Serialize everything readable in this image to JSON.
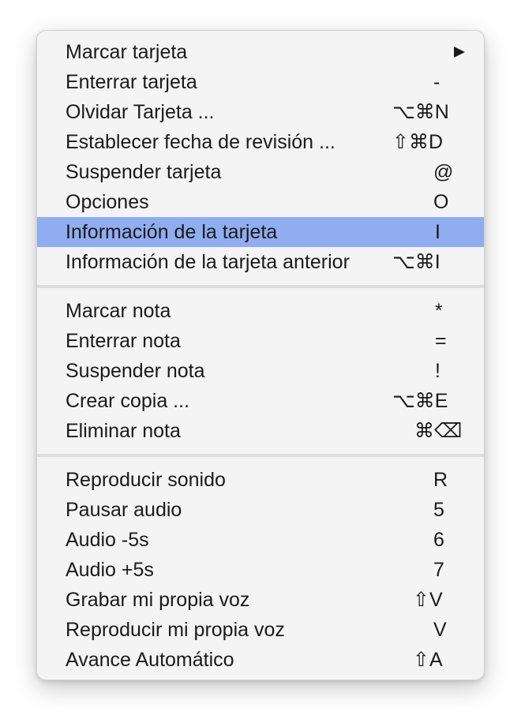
{
  "menu": {
    "items": [
      {
        "label": "Marcar tarjeta",
        "shortcut": "",
        "submenu": true
      },
      {
        "label": "Enterrar tarjeta",
        "shortcut": "-"
      },
      {
        "label": "Olvidar Tarjeta ...",
        "shortcut": "⌥⌘N"
      },
      {
        "label": "Establecer fecha de revisión ...",
        "shortcut": "⇧⌘D"
      },
      {
        "label": "Suspender tarjeta",
        "shortcut": "@"
      },
      {
        "label": "Opciones",
        "shortcut": "O"
      },
      {
        "label": "Información de la tarjeta",
        "shortcut": "I",
        "highlighted": true
      },
      {
        "label": "Información de la tarjeta anterior",
        "shortcut": "⌥⌘I"
      },
      {
        "label": "Marcar nota",
        "shortcut": "*"
      },
      {
        "label": "Enterrar nota",
        "shortcut": "="
      },
      {
        "label": "Suspender nota",
        "shortcut": "!"
      },
      {
        "label": "Crear copia ...",
        "shortcut": "⌥⌘E"
      },
      {
        "label": "Eliminar nota",
        "shortcut": "⌘⌫"
      },
      {
        "label": "Reproducir sonido",
        "shortcut": "R"
      },
      {
        "label": "Pausar audio",
        "shortcut": "5"
      },
      {
        "label": "Audio -5s",
        "shortcut": "6"
      },
      {
        "label": "Audio +5s",
        "shortcut": "7"
      },
      {
        "label": "Grabar mi propia voz",
        "shortcut": "⇧V"
      },
      {
        "label": "Reproducir mi propia voz",
        "shortcut": "V"
      },
      {
        "label": "Avance Automático",
        "shortcut": "⇧A"
      }
    ]
  },
  "colors": {
    "menu_bg": "#f4f4f4",
    "highlight": "#8fadf0",
    "separator": "#dedede",
    "text": "#1a1a1a"
  }
}
